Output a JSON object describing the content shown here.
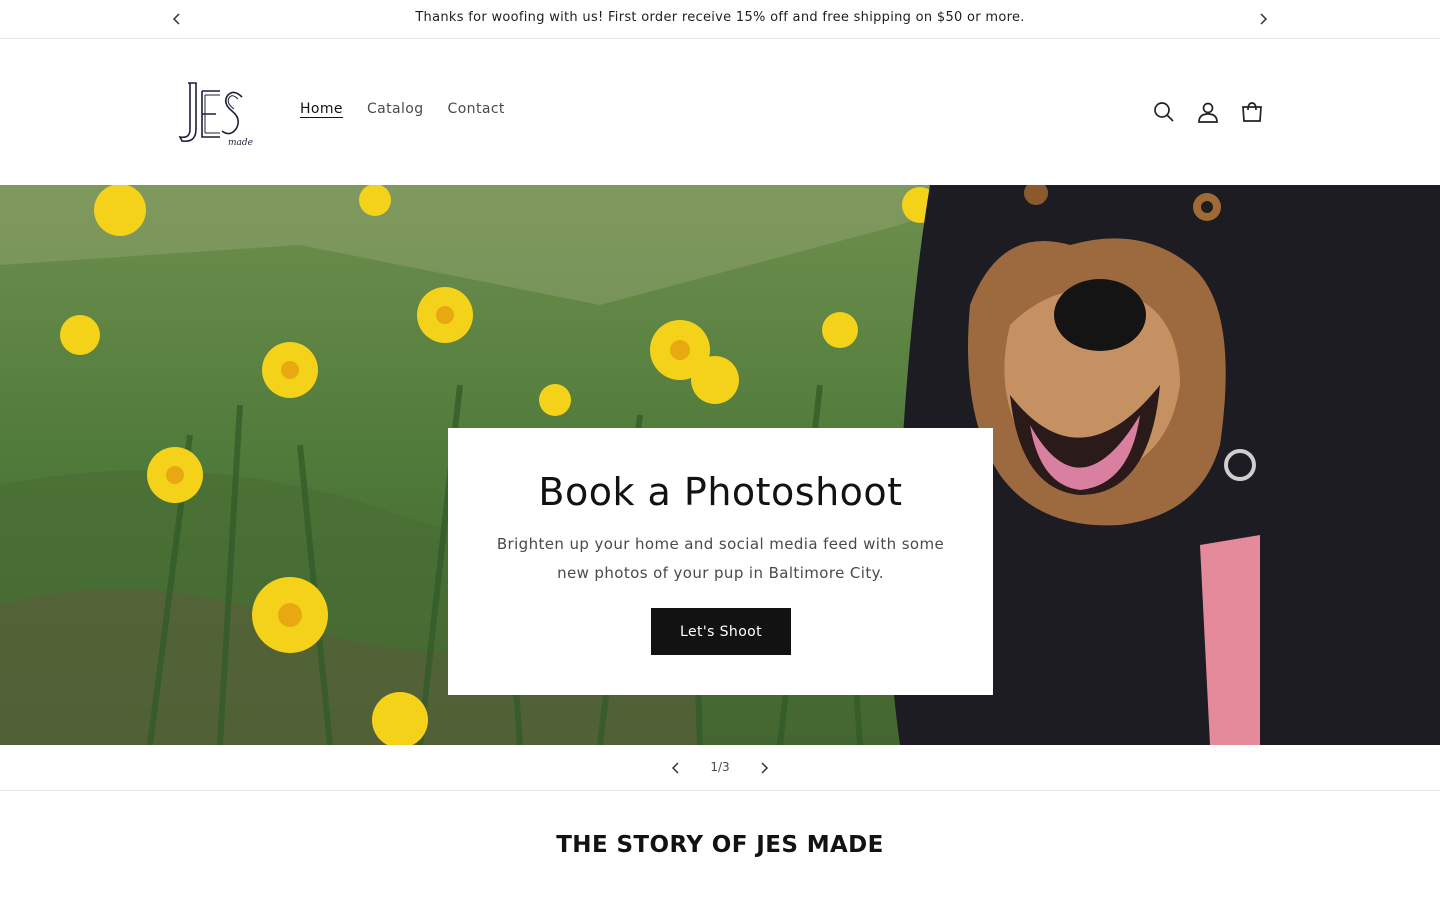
{
  "announcement": {
    "text": "Thanks for woofing with us! First order receive 15% off and free shipping on $50 or more.",
    "prev_icon": "chevron-left-icon",
    "next_icon": "chevron-right-icon"
  },
  "header": {
    "logo_text": "JES",
    "logo_subtext": "made",
    "nav": [
      {
        "label": "Home",
        "active": true
      },
      {
        "label": "Catalog",
        "active": false
      },
      {
        "label": "Contact",
        "active": false
      }
    ],
    "icons": [
      "search-icon",
      "account-icon",
      "cart-icon"
    ]
  },
  "hero": {
    "title": "Book a Photoshoot",
    "subtitle": "Brighten up your home and social media feed with some new photos of your pup in Baltimore City.",
    "button_label": "Let's Shoot"
  },
  "slider": {
    "count": "1/3",
    "prev_icon": "chevron-left-icon",
    "next_icon": "chevron-right-icon"
  },
  "story": {
    "title": "THE STORY OF JES MADE"
  }
}
